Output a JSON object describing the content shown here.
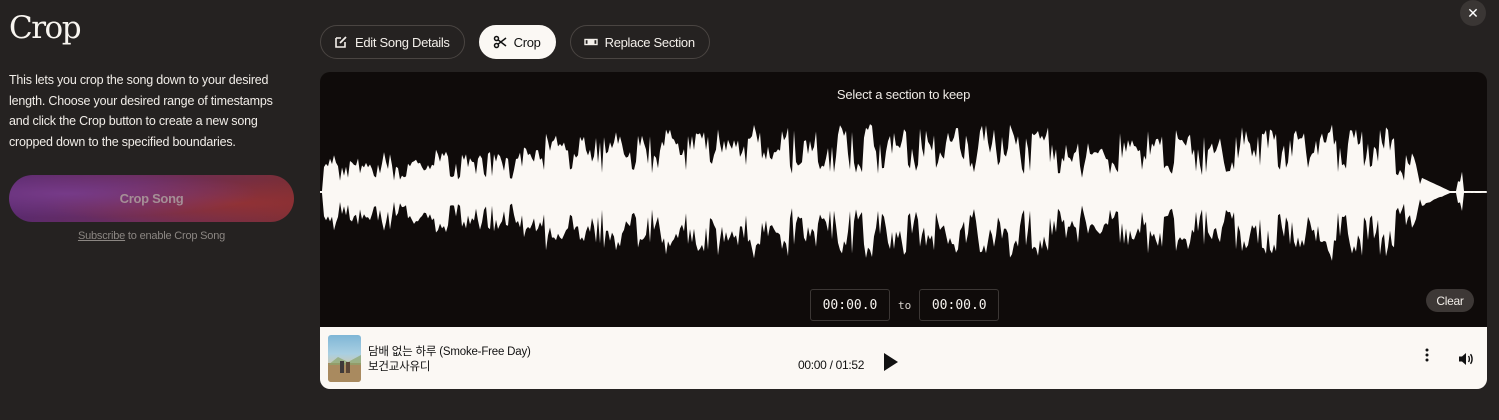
{
  "page": {
    "title": "Crop",
    "description": "This lets you crop the song down to your desired length. Choose your desired range of timestamps and click the Crop button to create a new song cropped down to the specified boundaries.",
    "crop_button": "Crop Song",
    "subscribe_link": "Subscribe",
    "subscribe_suffix": " to enable Crop Song",
    "close_icon": "close-icon"
  },
  "tabs": [
    {
      "label": "Edit Song Details",
      "icon": "edit-icon",
      "active": false
    },
    {
      "label": "Crop",
      "icon": "scissors-icon",
      "active": true
    },
    {
      "label": "Replace Section",
      "icon": "replace-section-icon",
      "active": false
    }
  ],
  "editor": {
    "hint": "Select a section to keep",
    "start_time": "00:00.0",
    "to_label": "to",
    "end_time": "00:00.0",
    "clear_button": "Clear"
  },
  "player": {
    "song_title": "담배 없는 하루 (Smoke-Free Day)",
    "artist": "보건교사유디",
    "time_display": "00:00 / 01:52",
    "play_icon": "play-icon",
    "more_icon": "more-vertical-icon",
    "volume_icon": "volume-icon"
  },
  "colors": {
    "background": "#252221",
    "editor_background": "#0f0b0a",
    "waveform": "#fbf8f4",
    "player_background": "#fbf8f4"
  }
}
